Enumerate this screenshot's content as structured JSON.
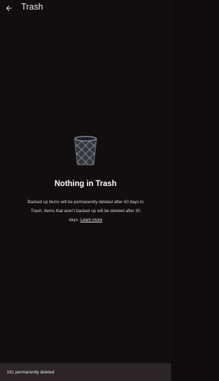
{
  "header": {
    "title": "Trash",
    "back_icon": "arrow-back-icon"
  },
  "empty_state": {
    "icon": "trash-bin-icon",
    "title": "Nothing in Trash",
    "description": "Backed up items will be permanently deleted after 60 days in Trash. Items that aren't backed up will be deleted after 30 days.",
    "learn_more": "Learn more"
  },
  "snackbar": {
    "message": "161 permanently deleted"
  }
}
